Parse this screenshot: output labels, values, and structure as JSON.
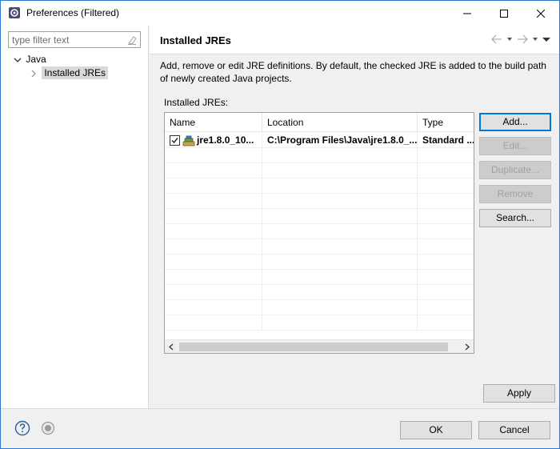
{
  "window": {
    "title": "Preferences (Filtered)",
    "accent_color": "#2b79d6"
  },
  "tree": {
    "filter_placeholder": "type filter text",
    "items": [
      {
        "label": "Java",
        "expanded": true
      },
      {
        "label": "Installed JREs",
        "selected": true
      }
    ]
  },
  "page": {
    "title": "Installed JREs",
    "description": "Add, remove or edit JRE definitions. By default, the checked JRE is added to the build path of newly created Java projects.",
    "section_label": "Installed JREs:"
  },
  "table": {
    "columns": [
      "Name",
      "Location",
      "Type"
    ],
    "rows": [
      {
        "checked": true,
        "name": "jre1.8.0_10...",
        "location": "C:\\Program Files\\Java\\jre1.8.0_...",
        "type": "Standard ..."
      }
    ]
  },
  "buttons": {
    "add": "Add...",
    "edit": "Edit...",
    "duplicate": "Duplicate...",
    "remove": "Remove",
    "search": "Search...",
    "apply": "Apply",
    "ok": "OK",
    "cancel": "Cancel"
  }
}
